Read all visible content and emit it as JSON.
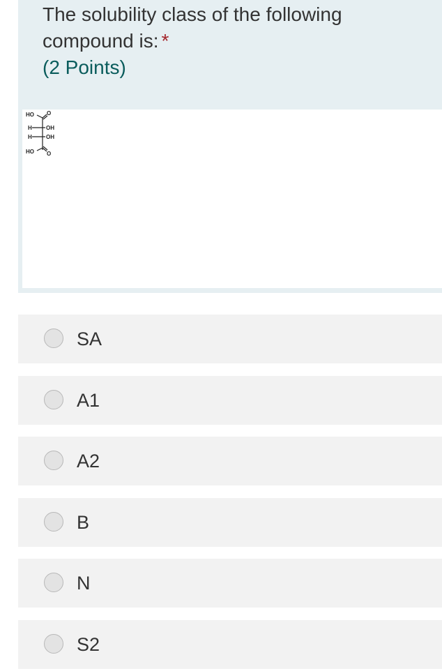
{
  "question": {
    "title": "The solubility class of the following compound is:",
    "required_marker": "*",
    "points": "(2 Points)"
  },
  "structure_labels": {
    "top_left": "HO",
    "top_right": "O",
    "row1_left": "H",
    "row1_right": "OH",
    "row2_left": "H",
    "row2_right": "OH",
    "bottom_left": "HO",
    "bottom_right": "O"
  },
  "options": [
    {
      "label": "SA"
    },
    {
      "label": "A1"
    },
    {
      "label": "A2"
    },
    {
      "label": "B"
    },
    {
      "label": "N"
    },
    {
      "label": "S2"
    }
  ],
  "colors": {
    "question_bg": "#e6eff2",
    "option_bg": "#f2f2f2",
    "points_color": "#0a5c5c",
    "required_color": "#a4262c"
  }
}
